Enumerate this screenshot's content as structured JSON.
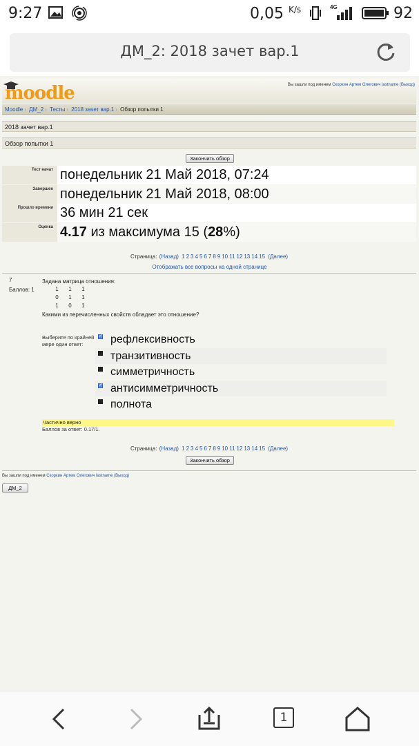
{
  "status": {
    "time": "9:27",
    "speed": "0,05",
    "speed_unit": "K/s",
    "network": "4G",
    "battery": "92"
  },
  "browser": {
    "title": "ДМ_2: 2018 зачет вар.1",
    "tab_count": "1"
  },
  "header": {
    "logo": "moodle",
    "logged_prefix": "Вы зашли под именем",
    "user_name": "Скоркин Артем Олегович lastname",
    "logout": "(Выход)"
  },
  "breadcrumb": [
    "Moodle",
    "ДМ_2",
    "Тесты",
    "2018 зачет вар.1",
    "Обзор попытки 1"
  ],
  "quiz_title": "2018 зачет вар.1",
  "review_title": "Обзор попытки 1",
  "finish_review_label": "Закончить обзор",
  "summary": [
    {
      "label": "Тест начат",
      "value": "понедельник 21 Май 2018, 07:24"
    },
    {
      "label": "Завершен",
      "value": "понедельник 21 Май 2018, 08:00"
    },
    {
      "label": "Прошло времени",
      "value": "36 мин 21 сек"
    },
    {
      "label": "Оценка",
      "score": "4.17",
      "of_text": " из максимума 15 (",
      "percent": "28",
      "suffix": "%)"
    }
  ],
  "pager": {
    "label": "Страница:",
    "prev": "(Назад)",
    "pages": [
      "1",
      "2",
      "3",
      "4",
      "5",
      "6",
      "7",
      "8",
      "9",
      "10",
      "11",
      "12",
      "13",
      "14",
      "15"
    ],
    "current": "7",
    "next": "(Далее)",
    "show_all": "Отображать все вопросы на одной странице"
  },
  "question": {
    "number": "7",
    "points": "Баллов: 1",
    "text": "Задана матрица отношения:",
    "matrix": [
      [
        "1",
        "1",
        "1"
      ],
      [
        "0",
        "1",
        "1"
      ],
      [
        "1",
        "0",
        "1"
      ]
    ],
    "question_line": "Какими из перечисленных свойств обладает это отношение?",
    "prompt": "Выберите по крайней мере один ответ:",
    "answers": [
      {
        "label": "рефлексивность",
        "checked": true
      },
      {
        "label": "транзитивность",
        "checked": false
      },
      {
        "label": "симметричность",
        "checked": false
      },
      {
        "label": "антисимметричность",
        "checked": true
      },
      {
        "label": "полнота",
        "checked": false
      }
    ],
    "feedback": "Частично верно",
    "score_line": "Баллов за ответ: 0.17/1."
  },
  "footer": {
    "course_button": "ДМ_2"
  }
}
